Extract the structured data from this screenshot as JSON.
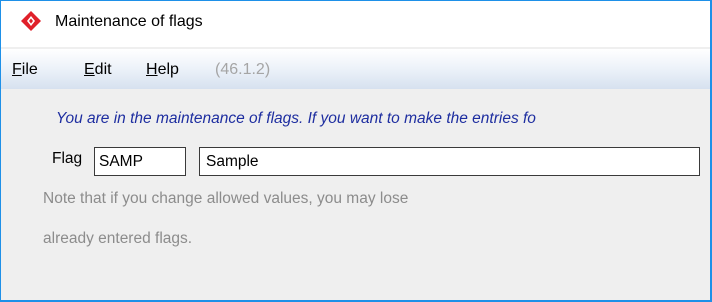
{
  "window": {
    "title": "Maintenance of flags",
    "icon": "red-diamond-app-icon"
  },
  "menubar": {
    "file_label": "File",
    "file_mnemonic": "F",
    "file_rest": "ile",
    "edit_label": "Edit",
    "edit_mnemonic": "E",
    "edit_rest": "dit",
    "help_label": "Help",
    "help_mnemonic": "H",
    "help_rest": "elp",
    "version": "(46.1.2)"
  },
  "content": {
    "info_text": "You are in the maintenance of flags. If you want to make the entries fo",
    "flag_label": "Flag",
    "flag_code_value": "SAMP",
    "flag_description_value": "Sample",
    "note_line_1": "Note that if you change allowed values, you may lose",
    "note_line_2": "already entered flags."
  },
  "colors": {
    "window_border": "#1e90e8",
    "info_text": "#1e2ea0",
    "note_text": "#8c8c8c",
    "version_text": "#a5a5a5",
    "app_icon_red": "#e0202a"
  }
}
